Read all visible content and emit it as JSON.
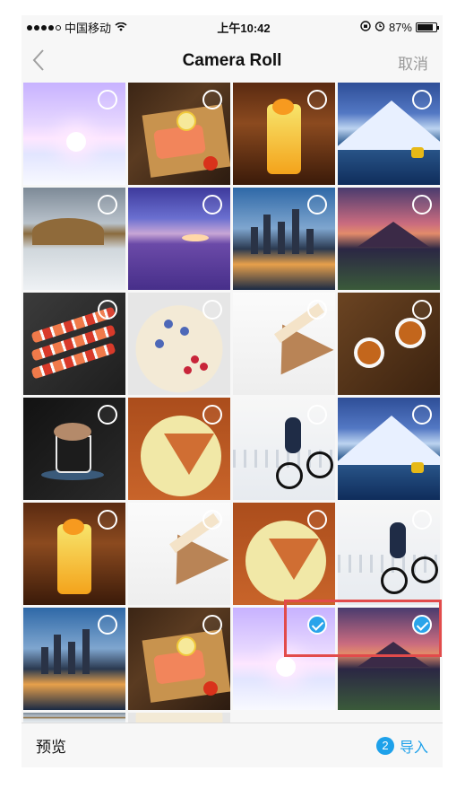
{
  "status_bar": {
    "carrier": "中国移动",
    "time": "上午10:42",
    "battery": "87%",
    "battery_level": 0.87
  },
  "nav": {
    "back_icon": "chevron-left-icon",
    "title": "Camera Roll",
    "cancel": "取消"
  },
  "photos": [
    {
      "id": "winter-forest",
      "checked": false
    },
    {
      "id": "salmon-board",
      "checked": false
    },
    {
      "id": "orange-juice",
      "checked": false
    },
    {
      "id": "mountain-lake",
      "checked": false
    },
    {
      "id": "misty-river",
      "checked": false
    },
    {
      "id": "lavender-field",
      "checked": false
    },
    {
      "id": "city-skyline",
      "checked": false
    },
    {
      "id": "fuji-sunset",
      "checked": false
    },
    {
      "id": "sushi-platter",
      "checked": false
    },
    {
      "id": "berry-tart",
      "checked": false
    },
    {
      "id": "cake-slice",
      "checked": false
    },
    {
      "id": "tea-cups",
      "checked": false
    },
    {
      "id": "coffee-mug",
      "checked": false
    },
    {
      "id": "pumpkin-pie",
      "checked": false
    },
    {
      "id": "bmx-rider",
      "checked": false
    },
    {
      "id": "mountain-lake-2",
      "checked": false
    },
    {
      "id": "orange-juice-2",
      "checked": false
    },
    {
      "id": "cake-slice-2",
      "checked": false
    },
    {
      "id": "pumpkin-pie-2",
      "checked": false
    },
    {
      "id": "bmx-rider-2",
      "checked": false
    },
    {
      "id": "city-skyline-2",
      "checked": false
    },
    {
      "id": "salmon-board-2",
      "checked": false
    },
    {
      "id": "winter-forest-2",
      "checked": true
    },
    {
      "id": "fuji-sunset-2",
      "checked": true
    }
  ],
  "toolbar": {
    "preview": "预览",
    "selected_count": "2",
    "import": "导入"
  },
  "colors": {
    "accent": "#1ea1ea",
    "highlight": "#e24b4b",
    "nav_gray": "#9a9a9a"
  }
}
